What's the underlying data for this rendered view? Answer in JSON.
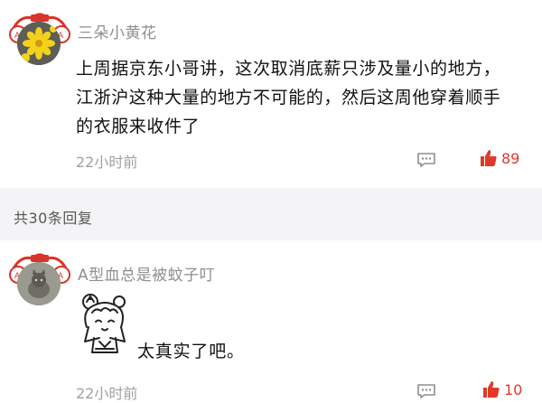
{
  "comments": [
    {
      "username": "三朵小黄花",
      "text_lines": [
        "上周据京东小哥讲，这次取消底薪只涉及量小的地方，",
        "江浙沪这种大量的地方不可能的，然后这周他穿着顺手",
        "的衣服来收件了"
      ],
      "time": "22小时前",
      "likes": "89",
      "avatar_icon": "flower-avatar-icon"
    }
  ],
  "replies_header": "共30条回复",
  "replies": [
    {
      "username": "A型血总是被蚊子叮",
      "text": "太真实了吧。",
      "time": "22小时前",
      "likes": "10",
      "avatar_icon": "cat-avatar-icon",
      "sticker_icon": "cartoon-girl-sticker-icon"
    }
  ],
  "colors": {
    "like": "#e0392b",
    "muted": "#a0a0a5",
    "band": "#f4f4f6"
  }
}
